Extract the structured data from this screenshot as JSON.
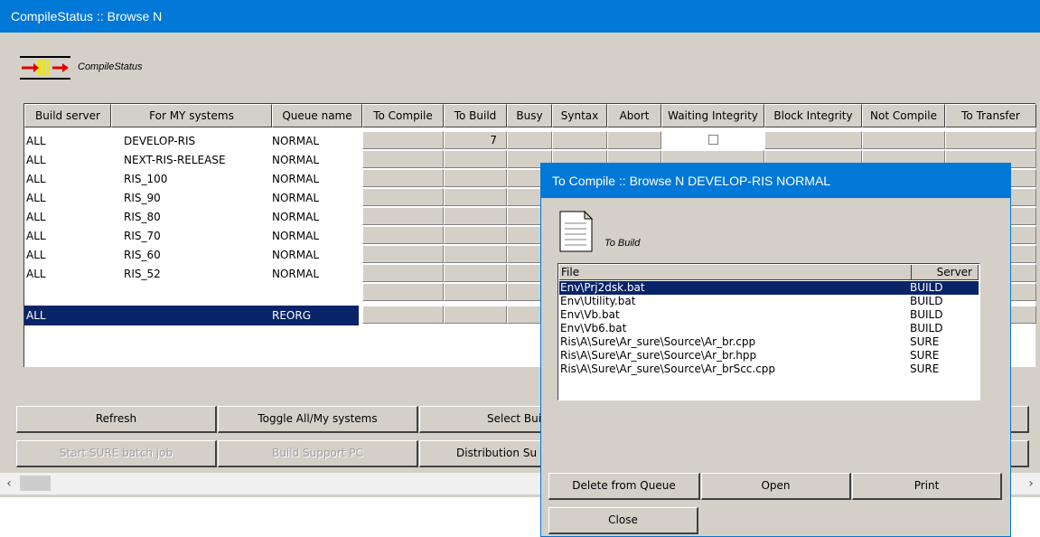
{
  "main_window": {
    "title": "CompileStatus :: Browse N",
    "header_label": "CompileStatus",
    "columns": [
      "Build server",
      "For MY systems",
      "Queue name",
      "To Compile",
      "To Build",
      "Busy",
      "Syntax",
      "Abort",
      "Waiting Integrity",
      "Block Integrity",
      "Not Compile",
      "To Transfer"
    ],
    "rows": [
      {
        "server": "ALL",
        "system": "DEVELOP-RIS",
        "queue": "NORMAL",
        "to_build": "7"
      },
      {
        "server": "ALL",
        "system": "NEXT-RIS-RELEASE",
        "queue": "NORMAL",
        "to_build": ""
      },
      {
        "server": "ALL",
        "system": "RIS_100",
        "queue": "NORMAL",
        "to_build": ""
      },
      {
        "server": "ALL",
        "system": "RIS_90",
        "queue": "NORMAL",
        "to_build": ""
      },
      {
        "server": "ALL",
        "system": "RIS_80",
        "queue": "NORMAL",
        "to_build": ""
      },
      {
        "server": "ALL",
        "system": "RIS_70",
        "queue": "NORMAL",
        "to_build": ""
      },
      {
        "server": "ALL",
        "system": "RIS_60",
        "queue": "NORMAL",
        "to_build": ""
      },
      {
        "server": "ALL",
        "system": "RIS_52",
        "queue": "NORMAL",
        "to_build": ""
      },
      {
        "server": "",
        "system": "",
        "queue": "",
        "to_build": ""
      },
      {
        "server": "ALL",
        "system": "",
        "queue": "REORG",
        "to_build": ""
      }
    ],
    "selected_row": 9,
    "buttons_row1": [
      "Refresh",
      "Toggle All/My systems",
      "Select Build"
    ],
    "buttons_row2": [
      "Start SURE batch job",
      "Build Support PC",
      "Distribution Su"
    ],
    "scroll_left_icon": "chevron-left-icon",
    "scroll_right_icon": "chevron-right-icon"
  },
  "dialog": {
    "title": "To Compile :: Browse N DEVELOP-RIS NORMAL",
    "header_label": "To Build",
    "list_headers": {
      "file": "File",
      "server": "Server"
    },
    "files": [
      {
        "file": "Env\\Prj2dsk.bat",
        "server": "BUILD"
      },
      {
        "file": "Env\\Utility.bat",
        "server": "BUILD"
      },
      {
        "file": "Env\\Vb.bat",
        "server": "BUILD"
      },
      {
        "file": "Env\\Vb6.bat",
        "server": "BUILD"
      },
      {
        "file": "Ris\\A\\Sure\\Ar_sure\\Source\\Ar_br.cpp",
        "server": "SURE"
      },
      {
        "file": "Ris\\A\\Sure\\Ar_sure\\Source\\Ar_br.hpp",
        "server": "SURE"
      },
      {
        "file": "Ris\\A\\Sure\\Ar_sure\\Source\\Ar_brScc.cpp",
        "server": "SURE"
      }
    ],
    "selected_file": 0,
    "buttons": {
      "delete": "Delete from Queue",
      "open": "Open",
      "print": "Print",
      "close": "Close"
    }
  },
  "colors": {
    "titlebar": "#0078d7",
    "selection": "#0a246a",
    "face": "#d4d0c8"
  }
}
